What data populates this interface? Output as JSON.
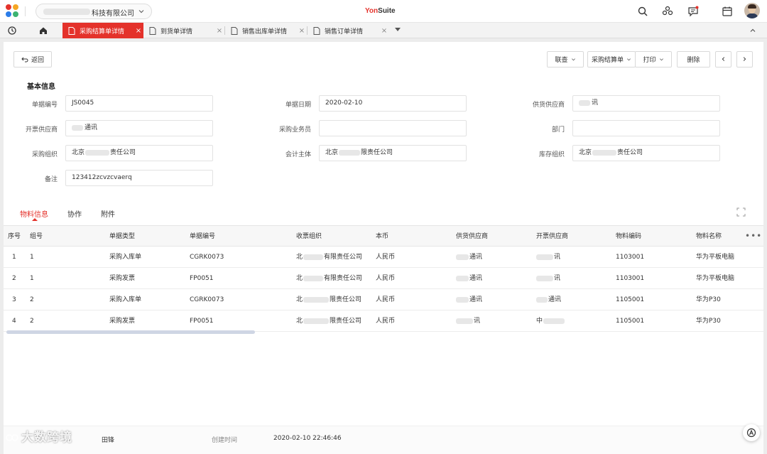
{
  "header": {
    "org_name": "科技有限公司",
    "brand_part1": "Yon",
    "brand_part2": "Suite"
  },
  "tabs": [
    {
      "label": "采购结算单详情",
      "active": true
    },
    {
      "label": "到货单详情",
      "active": false
    },
    {
      "label": "销售出库单详情",
      "active": false
    },
    {
      "label": "销售订单详情",
      "active": false
    }
  ],
  "tab_close": "×",
  "toolbar": {
    "back": "返回",
    "linked_query": "联查",
    "settlement": "采购结算单",
    "print": "打印",
    "delete": "删除",
    "prev": "‹",
    "next": "›"
  },
  "basic_info": {
    "title": "基本信息",
    "fields": {
      "doc_no": {
        "label": "单据编号",
        "value": "JS0045"
      },
      "doc_date": {
        "label": "单据日期",
        "value": "2020-02-10"
      },
      "supplier": {
        "label": "供货供应商",
        "value": "讯"
      },
      "invoice_supplier": {
        "label": "开票供应商",
        "value": "通讯"
      },
      "purchaser": {
        "label": "采购业务员",
        "value": ""
      },
      "dept": {
        "label": "部门",
        "value": ""
      },
      "purchase_org": {
        "label": "采购组织",
        "value_pre": "北京",
        "value_post": "责任公司"
      },
      "accounting": {
        "label": "会计主体",
        "value_pre": "北京",
        "value_post": "限责任公司"
      },
      "stock_org": {
        "label": "库存组织",
        "value_pre": "北京",
        "value_post": "责任公司"
      },
      "remark": {
        "label": "备注",
        "value": "123412zcvzcvaerq"
      }
    }
  },
  "sub_tabs": [
    {
      "label": "物料信息",
      "active": true
    },
    {
      "label": "协作",
      "active": false
    },
    {
      "label": "附件",
      "active": false
    }
  ],
  "table": {
    "columns": [
      "序号",
      "组号",
      "单据类型",
      "单据编号",
      "收票组织",
      "本币",
      "供货供应商",
      "开票供应商",
      "物料编码",
      "物料名称"
    ],
    "more": "•••",
    "rows": [
      {
        "seq": "1",
        "group": "1",
        "type": "采购入库单",
        "doc": "CGRK0073",
        "org_pre": "北",
        "org_post": "有限责任公司",
        "currency": "人民币",
        "supplier": "通讯",
        "inv_supplier": "讯",
        "code": "1103001",
        "name": "华为平板电脑"
      },
      {
        "seq": "2",
        "group": "1",
        "type": "采购发票",
        "doc": "FP0051",
        "org_pre": "北",
        "org_post": "有限责任公司",
        "currency": "人民币",
        "supplier": "通讯",
        "inv_supplier": "讯",
        "code": "1103001",
        "name": "华为平板电脑"
      },
      {
        "seq": "3",
        "group": "2",
        "type": "采购入库单",
        "doc": "CGRK0073",
        "org_pre": "北",
        "org_post": "限责任公司",
        "currency": "人民币",
        "supplier": "通讯",
        "inv_supplier": "通讯",
        "code": "1105001",
        "name": "华为P30"
      },
      {
        "seq": "4",
        "group": "2",
        "type": "采购发票",
        "doc": "FP0051",
        "org_pre": "北",
        "org_post": "限责任公司",
        "currency": "人民币",
        "supplier": "讯",
        "inv_supplier": "中",
        "code": "1105001",
        "name": "华为P30"
      }
    ]
  },
  "footer": {
    "creator": "田锋",
    "created_label": "创建时间",
    "created_value": "2020-02-10 22:46:46"
  },
  "watermark": "大数跨境",
  "colors": {
    "accent": "#e4322b",
    "scrollbar": "#cfd6e4"
  }
}
